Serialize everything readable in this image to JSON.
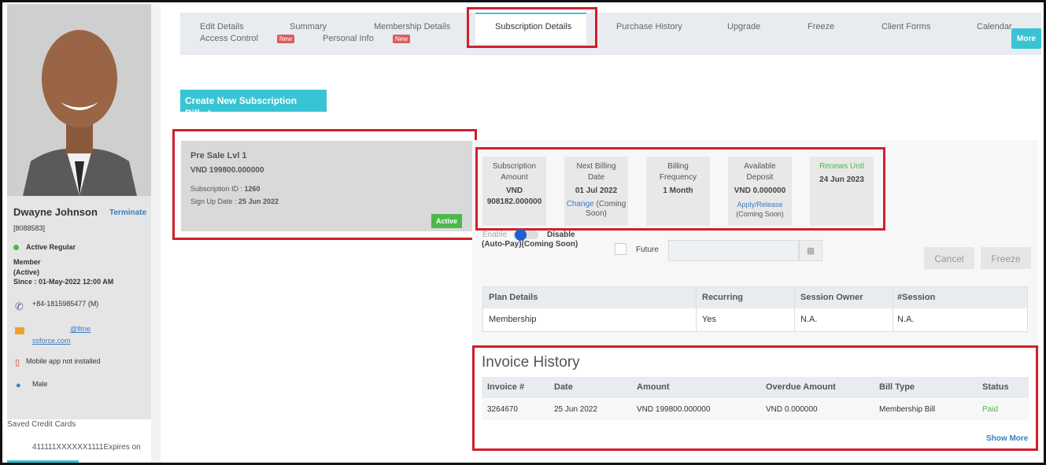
{
  "tabs": {
    "row1": [
      "Edit Details",
      "Summary",
      "Membership Details",
      "Subscription Details",
      "Purchase History",
      "Upgrade",
      "Freeze",
      "Client Forms",
      "Calendar"
    ],
    "row2": [
      "Access Control",
      "Personal Info"
    ],
    "new_badge": "New",
    "more": "More"
  },
  "profile": {
    "name": "Dwayne Johnson",
    "terminate": "Terminate",
    "id": "[8088583]",
    "status": "Active Regular",
    "member_line1": "Member",
    "member_line2": "(Active)",
    "since_label": "Since : ",
    "since_value": "01-May-2022 12:00 AM",
    "phone": "+84-1815985477 (M)",
    "email_part1": "@fitne",
    "email_part2": "ssforce.com",
    "mobile_app": "Mobile app not installed",
    "gender": "Male",
    "saved_cards_label": "Saved Credit Cards",
    "card_info": "411111XXXXXX1111Expires on"
  },
  "create_button": "Create New Subscription Bill",
  "subscription": {
    "name": "Pre Sale Lvl 1",
    "price": "VND 199800.000000",
    "id_label": "Subscription ID : ",
    "id_value": "1260",
    "signup_label": "Sign Up Date : ",
    "signup_value": "25 Jun 2022",
    "status": "Active"
  },
  "stats": {
    "amount_l1": "Subscription",
    "amount_l2": "Amount",
    "amount_v1": "VND",
    "amount_v2": "908182.000000",
    "next_l1": "Next Billing",
    "next_l2": "Date",
    "next_v": "01 Jul 2022",
    "next_link": "Change",
    "next_note1": " (Coming",
    "next_note2": "Soon)",
    "freq_l1": "Billing",
    "freq_l2": "Frequency",
    "freq_v": "1 Month",
    "dep_l1": "Available",
    "dep_l2": "Deposit",
    "dep_v": "VND 0.000000",
    "dep_link": "Apply/Release",
    "dep_note": "(Coming Soon)",
    "renew_l": "Renews Untl",
    "renew_v": "24 Jun 2023"
  },
  "autopay": {
    "enable": "Enable",
    "disable": "Disable",
    "note": "(Auto-Pay)(Coming Soon)",
    "future": "Future",
    "cancel": "Cancel",
    "freeze": "Freeze"
  },
  "plan_table": {
    "headers": [
      "Plan Details",
      "Recurring",
      "Session Owner",
      "#Session"
    ],
    "row": [
      "Membership",
      "Yes",
      "N.A.",
      "N.A."
    ]
  },
  "invoice": {
    "title": "Invoice History",
    "headers": [
      "Invoice #",
      "Date",
      "Amount",
      "Overdue Amount",
      "Bill Type",
      "Status"
    ],
    "row": [
      "3264670",
      "25 Jun 2022",
      "VND 199800.000000",
      "VND 0.000000",
      "Membership Bill",
      "Paid"
    ],
    "show_more": "Show More"
  },
  "colors": {
    "accent": "#38c4d4",
    "highlight": "#d21f2a",
    "active_green": "#4cb84c",
    "link": "#3b7dc4"
  }
}
